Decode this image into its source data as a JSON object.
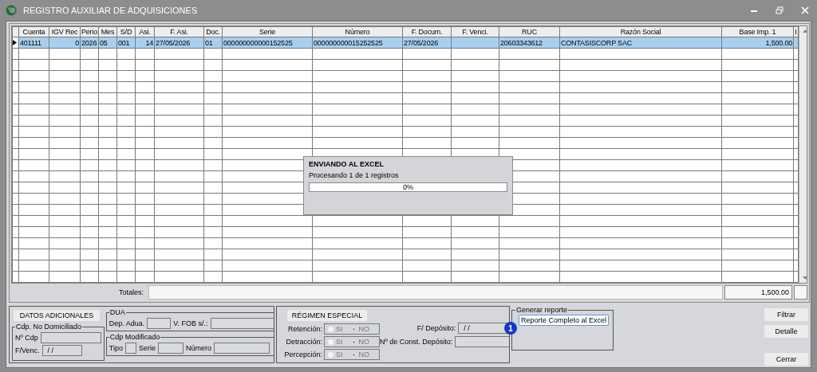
{
  "window": {
    "title": "REGISTRO AUXILIAR DE ADQUISICIONES"
  },
  "table": {
    "columns": [
      {
        "label": "Cuenta"
      },
      {
        "label": "IGV Rec"
      },
      {
        "label": "Perio"
      },
      {
        "label": "Mes"
      },
      {
        "label": "S/D"
      },
      {
        "label": "Asi."
      },
      {
        "label": "F. Asi."
      },
      {
        "label": "Doc."
      },
      {
        "label": "Serie"
      },
      {
        "label": "Número"
      },
      {
        "label": "F. Docum."
      },
      {
        "label": "F. Venci."
      },
      {
        "label": "RUC"
      },
      {
        "label": "Razón Social"
      },
      {
        "label": "Base Imp. 1"
      },
      {
        "label": "I"
      }
    ],
    "rows": [
      {
        "selected": true,
        "cells": [
          "401111",
          "0",
          "2026",
          "05",
          "001",
          "14",
          "27/05/2026",
          "01",
          "000000000000152525",
          "000000000015252525",
          "27/05/2026",
          null,
          "20603343612",
          "CONTASISCORP SAC",
          "1,500.00",
          null
        ]
      }
    ]
  },
  "totals": {
    "label": "Totales:",
    "base": "1,500.00"
  },
  "progress_dialog": {
    "title": "ENVIANDO AL EXCEL",
    "message": "Procesando 1 de 1 registros",
    "level": 0,
    "reading": "0%"
  },
  "datos_adicionales": {
    "button": "DATOS ADICIONALES",
    "no_domiciliado": {
      "legend": "Cdp. No Domiciliado",
      "fields": [
        {
          "label": "Nº Cdp"
        },
        {
          "label": "F/Venc.",
          "value": "/ /"
        }
      ]
    },
    "dua": {
      "legend": "DUA",
      "fields": [
        {
          "label": "Dep. Adua."
        },
        {
          "label": "V. FOB s/.:"
        }
      ]
    },
    "cdp_modificado": {
      "legend": "Cdp Modificado",
      "fields": [
        {
          "label": "Tipo"
        },
        {
          "label": "Serie"
        },
        {
          "label": "Número"
        }
      ]
    }
  },
  "regimen": {
    "button": "RÉGIMEN ESPECIAL",
    "options": [
      {
        "label": "Retención:",
        "choices": [
          {
            "label": "SI",
            "selected": false
          },
          {
            "label": "NO",
            "selected": true
          }
        ]
      },
      {
        "label": "Detracción:",
        "choices": [
          {
            "label": "SI",
            "selected": false
          },
          {
            "label": "NO",
            "selected": true
          }
        ]
      },
      {
        "label": "Percepción:",
        "choices": [
          {
            "label": "SI",
            "selected": false
          },
          {
            "label": "NO",
            "selected": true
          }
        ]
      }
    ],
    "deposit_fields": [
      {
        "label": "F/ Depósito:",
        "value": "/ /"
      },
      {
        "label": "Nº de Const. Depósito:"
      }
    ]
  },
  "report": {
    "legend": "Generar reporte",
    "badge": "1",
    "button": "Reporte Completo al Excel"
  },
  "buttons": [
    "Filtrar",
    "Detalle",
    "Cerrar"
  ]
}
